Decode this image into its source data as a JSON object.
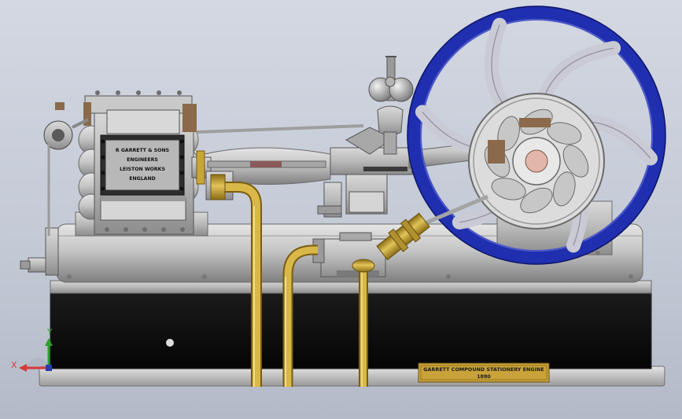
{
  "nameplate": {
    "line1": "R GARRETT & SONS",
    "line2": "ENGINEERS",
    "line3": "LEISTON WORKS",
    "line4": "ENGLAND"
  },
  "plaque": {
    "line1": "GARRETT COMPOUND STATIONERY ENGINE",
    "line2": "1880"
  },
  "triad": {
    "x_label": "X",
    "y_label": "Y"
  },
  "colors": {
    "flywheel_rim": "#1f2fb0",
    "brass": "#c8a53a",
    "base": "#0d0d0d",
    "plaque_bg": "#c9a23a",
    "metal": "#b4b4b4"
  }
}
